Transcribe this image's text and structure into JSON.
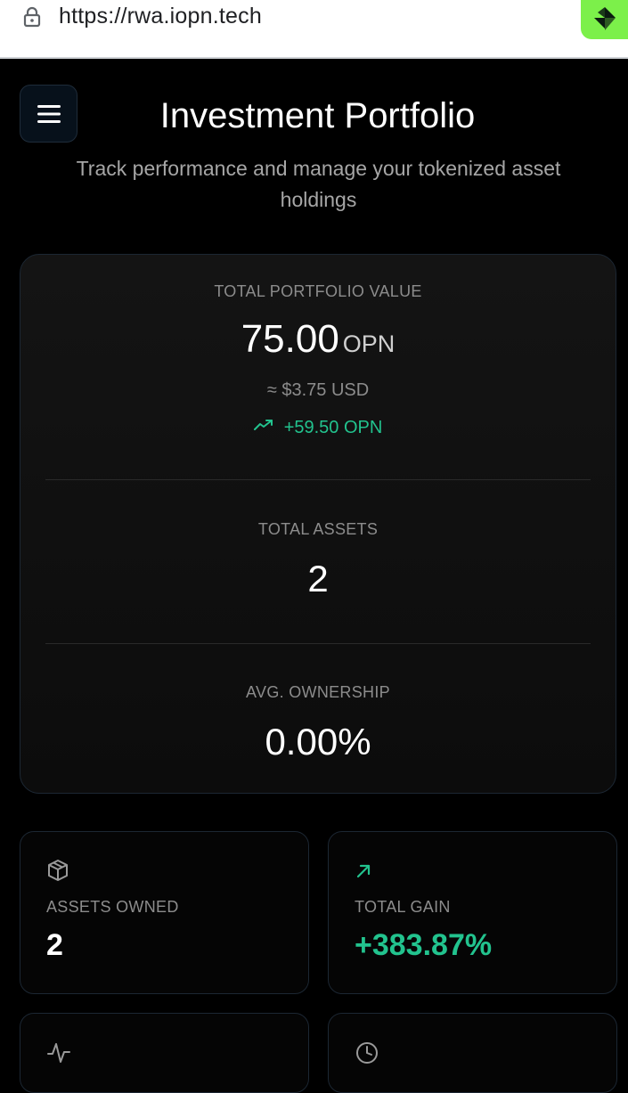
{
  "browser": {
    "url": "https://rwa.iopn.tech"
  },
  "header": {
    "title": "Investment Portfolio",
    "subtitle": "Track performance and manage your tokenized asset holdings"
  },
  "summary": {
    "portfolio_value_label": "TOTAL PORTFOLIO VALUE",
    "portfolio_value": "75.00",
    "portfolio_unit": "OPN",
    "usd_value": "≈ $3.75 USD",
    "change": "+59.50 OPN",
    "total_assets_label": "TOTAL ASSETS",
    "total_assets": "2",
    "avg_ownership_label": "AVG. OWNERSHIP",
    "avg_ownership": "0.00%"
  },
  "cards": {
    "assets_owned_label": "ASSETS OWNED",
    "assets_owned": "2",
    "total_gain_label": "TOTAL GAIN",
    "total_gain": "+383.87%"
  },
  "icons": {
    "lock": "lock-icon",
    "menu": "menu-icon",
    "trend": "trending-up-icon",
    "box": "box-icon",
    "arrow": "arrow-up-right-icon",
    "activity": "activity-icon",
    "clock": "clock-icon"
  },
  "colors": {
    "accent_green": "#22c38e",
    "badge_green": "#7cf04a",
    "background": "#000000"
  }
}
